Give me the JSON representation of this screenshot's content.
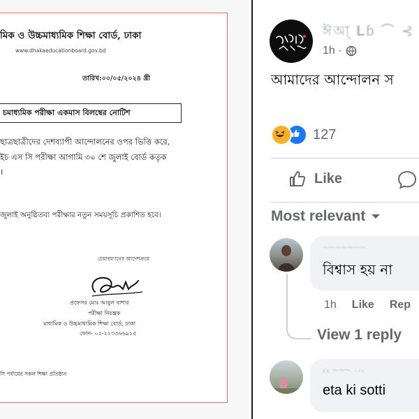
{
  "notice": {
    "board_name": "মিক ও উচ্চমাধ্যমিক শিক্ষা বোর্ড, ঢাকা",
    "website": "www.dhakaeducationboard.gov.bd",
    "date": "তারিখ:০০/০৫/২০২৪ খ্রী",
    "subject": "চমাধ্যমিক পরীক্ষা একমাস বিলম্বের নোটিশ",
    "body_line_1": "ছাত্রছাত্রীদের দেশব্যাপী আন্দোলনের ওপর ভিত্তি করে,",
    "body_line_2": "ইচ এস সি পরীক্ষা আগামি ৩০ শে জুলাই বোর্ড কতৃক",
    "body_line_3": "।",
    "body_line_4": "জুলাই অনুষ্ঠিতব্য পরীক্ষার নতুন সময়সূচি প্রকাশিত হবে।",
    "by_order": "চেয়ারম্যানের আদেশক্রমে",
    "signatory_name": "প্রফেসর মোঃ আবুল বাশার",
    "signatory_title": "পরীক্ষা নিয়ন্ত্রক",
    "signatory_org": "মাধ্যমিক ও উচ্চমাধ্যমিক শিক্ষা বোর্ড, ঢাকা",
    "signatory_phone": "ফোন- ০২-২২৩৩৬৬৯১৫",
    "copy_to": "সি পর্যায়ের সকল শিক্ষা প্রতিষ্ঠান"
  },
  "post": {
    "author": "ঈআ্ 𝐋ɓ ⌒ ⊰ ♪",
    "time": "1h ·",
    "text": "আমাদের আন্দোলন স",
    "reaction_count": "127",
    "like_label": "Like",
    "sort_label": "Most relevant"
  },
  "comments": [
    {
      "name": "~~~~~~~",
      "text": "বিশ্বাস হয় না",
      "time": "1h",
      "like_label": "Like",
      "reply_label": "Rep",
      "view_replies": "View 1 reply"
    },
    {
      "name": "‹‹ ~~~ ···",
      "text": "eta ki sotti"
    }
  ],
  "colors": {
    "notice_border": "#e86a6a",
    "fb_secondary_text": "#65676b",
    "fb_blue": "#1877f2",
    "bubble_bg": "#f0f2f5"
  },
  "icons": [
    "globe-icon",
    "haha-reaction-icon",
    "like-reaction-icon",
    "thumbs-up-icon",
    "comment-icon",
    "chevron-down-icon"
  ]
}
